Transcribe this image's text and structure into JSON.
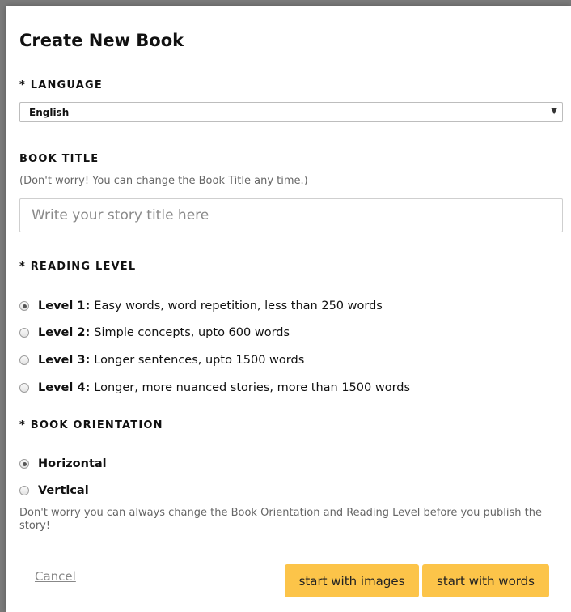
{
  "dialog": {
    "title": "Create New Book"
  },
  "language": {
    "label": "* LANGUAGE",
    "selected": "English",
    "arrow_icon": "caret-down"
  },
  "book_title": {
    "label": "BOOK TITLE",
    "hint": "(Don't worry! You can change the Book Title any time.)",
    "value": "",
    "placeholder": "Write your story title here"
  },
  "reading_level": {
    "label": "* READING LEVEL",
    "options": [
      {
        "name": "Level 1:",
        "desc": "Easy words, word repetition, less than 250 words",
        "checked": true
      },
      {
        "name": "Level 2:",
        "desc": "Simple concepts, upto 600 words",
        "checked": false
      },
      {
        "name": "Level 3:",
        "desc": "Longer sentences, upto 1500 words",
        "checked": false
      },
      {
        "name": "Level 4:",
        "desc": "Longer, more nuanced stories, more than 1500 words",
        "checked": false
      }
    ]
  },
  "orientation": {
    "label": "* BOOK ORIENTATION",
    "options": [
      {
        "name": "Horizontal",
        "checked": true
      },
      {
        "name": "Vertical",
        "checked": false
      }
    ],
    "note": "Don't worry you can always change the Book Orientation and Reading Level before you publish the story!"
  },
  "actions": {
    "cancel": "Cancel",
    "start_images": "start with images",
    "start_words": "start with words",
    "button_color": "#fcc449"
  }
}
